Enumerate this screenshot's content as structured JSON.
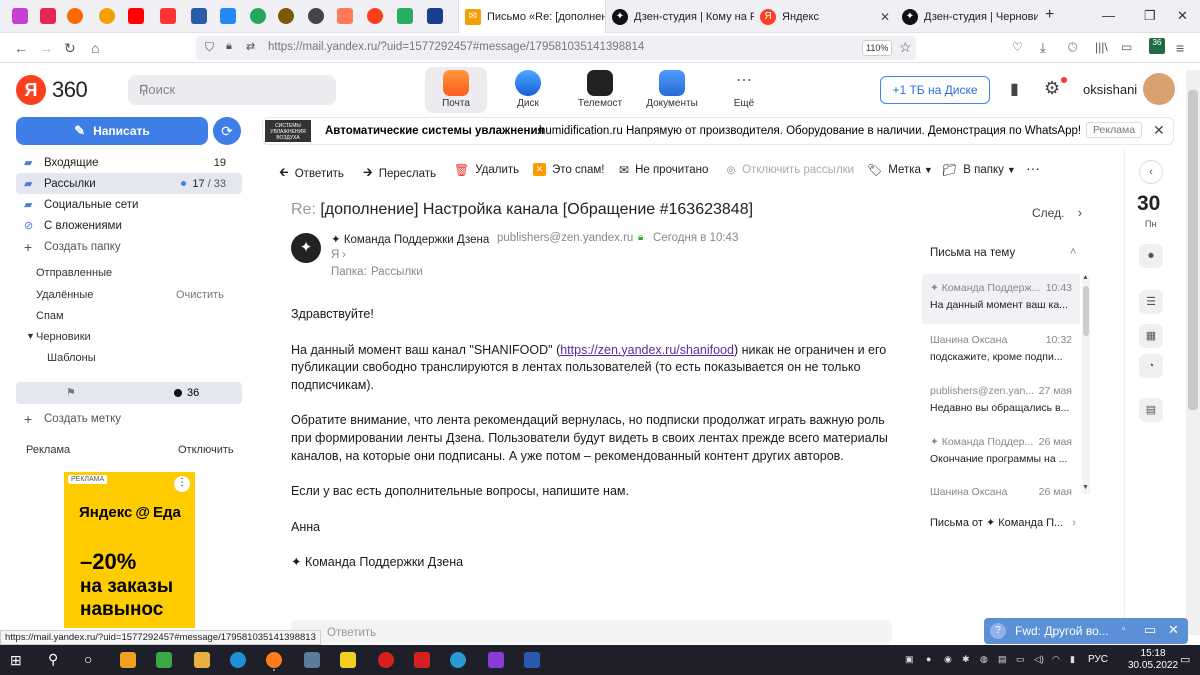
{
  "browser": {
    "tabs": [
      {
        "title": "Письмо «Re: [дополнени",
        "active": true
      },
      {
        "title": "Дзен-студия | Кому на Ру"
      },
      {
        "title": "Яндекс"
      },
      {
        "title": "Дзен-студия | Черновик"
      }
    ],
    "url": "https://mail.yandex.ru/?uid=1577292457#message/179581035141398814",
    "zoom": "110%",
    "badge": "36"
  },
  "header": {
    "logo_text": "360",
    "logo_letter": "Я",
    "search_placeholder": "Поиск",
    "services": [
      "Почта",
      "Диск",
      "Телемост",
      "Документы",
      "Ещё"
    ],
    "storage_button": "+1 ТБ на Диске",
    "username": "oksishani"
  },
  "sidebar": {
    "compose_label": "Написать",
    "folders": [
      {
        "label": "Входящие",
        "count": "19"
      },
      {
        "label": "Рассылки",
        "count": "17",
        "total": "/ 33"
      },
      {
        "label": "Социальные сети"
      },
      {
        "label": "С вложениями"
      }
    ],
    "create_folder": "Создать папку",
    "system": [
      {
        "label": "Отправленные"
      },
      {
        "label": "Удалённые",
        "action": "Очистить"
      },
      {
        "label": "Спам"
      },
      {
        "label": "Черновики"
      },
      {
        "label": "Шаблоны"
      }
    ],
    "labels_count": "36",
    "create_label": "Создать метку",
    "ads_label": "Реклама",
    "ads_off": "Отключить",
    "ad": {
      "tag": "РЕКЛАМА",
      "brand": "Яндекс",
      "brand2": "Еда",
      "discount": "–20%",
      "line1": "на заказы",
      "line2": "навынос"
    }
  },
  "ad_banner": {
    "logo_text": "СИСТЕМЫ УВЛАЖНЕНИЯ ВОЗДУХА",
    "title": "Автоматические системы увлажнения",
    "domain": "humidification.ru",
    "text": "Напрямую от производителя. Оборудование в наличии. Демонстрация по WhatsApp!",
    "tag": "Реклама"
  },
  "toolbar": {
    "reply": "Ответить",
    "forward": "Переслать",
    "delete": "Удалить",
    "spam": "Это спам!",
    "unread": "Не прочитано",
    "unsubscribe": "Отключить рассылки",
    "label": "Метка",
    "folder": "В папку"
  },
  "message": {
    "subject_prefix": "Re:",
    "subject": "[дополнение] Настройка канала  [Обращение #163623848]",
    "next": "След.",
    "sender": "✦ Команда Поддержки Дзена",
    "sender_email": "publishers@zen.yandex.ru",
    "date": "Сегодня в 10:43",
    "to": "Я",
    "folder_label": "Папка:",
    "folder": "Рассылки",
    "greeting": "Здравствуйте!",
    "p1_a": "На данный момент ваш канал \"SHANIFOOD\" (",
    "p1_link": "https://zen.yandex.ru/shanifood",
    "p1_b": ") никак не ограничен и его публикации свободно транслируются в лентах пользователей (то есть показывается он не только подписчикам).",
    "p2": "Обратите внимание, что лента рекомендаций вернулась, но подписки продолжат играть важную роль при формировании ленты Дзена. Пользователи будут видеть в своих лентах прежде всего материалы каналов, на которые они подписаны. А уже потом – рекомендованный контент других авторов.",
    "p3": "Если у вас есть дополнительные вопросы, напишите нам.",
    "signature_name": "Анна",
    "signature_team": "✦ Команда Поддержки Дзена",
    "reply_placeholder": "Ответить"
  },
  "thread": {
    "title": "Письма на тему",
    "items": [
      {
        "from": "✦ Команда Поддерж...",
        "time": "10:43",
        "snippet": "На данный момент ваш ка..."
      },
      {
        "from": "Шанина Оксана",
        "time": "10:32",
        "snippet": "подскажите, кроме подпи..."
      },
      {
        "from": "publishers@zen.yan...",
        "time": "27 мая",
        "snippet": "Недавно вы обращались в..."
      },
      {
        "from": "✦ Команда Поддер...",
        "time": "26 мая",
        "snippet": "Окончание программы на ..."
      },
      {
        "from": "Шанина Оксана",
        "time": "26 мая",
        "snippet": ""
      }
    ],
    "from_link": "Письма от ✦ Команда П..."
  },
  "rightbar": {
    "date": "30",
    "weekday": "Пн"
  },
  "notification": "Fwd: Другой во...",
  "status_url": "https://mail.yandex.ru/?uid=1577292457#message/179581035141398813",
  "taskbar": {
    "lang": "РУС",
    "time": "15:18",
    "date": "30.05.2022"
  }
}
